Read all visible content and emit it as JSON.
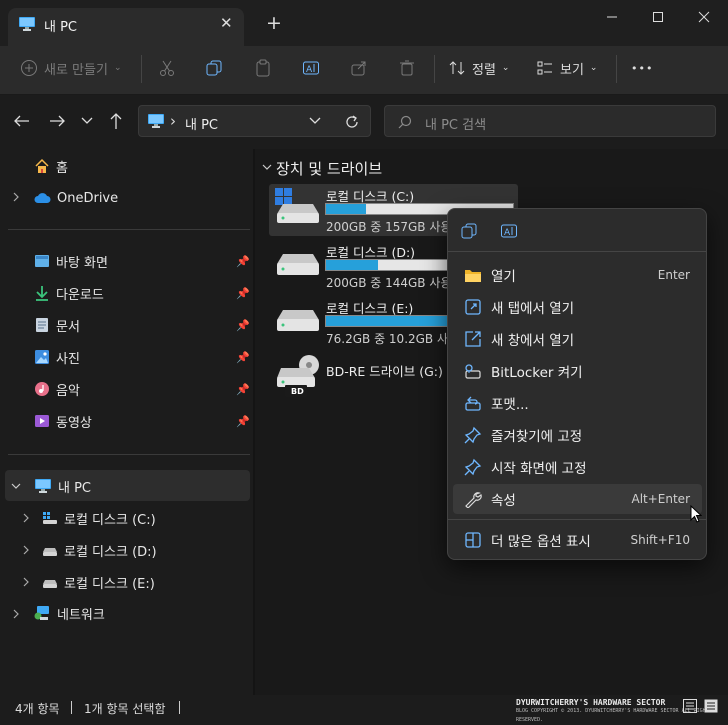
{
  "window": {
    "tab_title": "내 PC",
    "tab_close": "✕",
    "tab_add": "+"
  },
  "toolbar": {
    "new_label": "새로 만들기",
    "sort_label": "정렬",
    "view_label": "보기",
    "more_label": "•••"
  },
  "address": {
    "separator": "›",
    "path": "내 PC"
  },
  "search": {
    "placeholder": "내 PC 검색"
  },
  "sidebar": {
    "home": "홈",
    "onedrive": "OneDrive",
    "pinned": [
      {
        "label": "바탕 화면",
        "icon": "desktop-icon"
      },
      {
        "label": "다운로드",
        "icon": "download-icon"
      },
      {
        "label": "문서",
        "icon": "documents-icon"
      },
      {
        "label": "사진",
        "icon": "pictures-icon"
      },
      {
        "label": "음악",
        "icon": "music-icon"
      },
      {
        "label": "동영상",
        "icon": "videos-icon"
      }
    ],
    "this_pc": "내 PC",
    "drives": [
      "로컬 디스크 (C:)",
      "로컬 디스크 (D:)",
      "로컬 디스크 (E:)"
    ],
    "network": "네트워크"
  },
  "content": {
    "group_header": "장치 및 드라이브",
    "drives": [
      {
        "name": "로컬 디스크 (C:)",
        "size_text": "200GB 중 157GB 사용 가능",
        "used_fraction": 0.215
      },
      {
        "name": "로컬 디스크 (D:)",
        "size_text": "200GB 중 144GB 사용 가능",
        "used_fraction": 0.28
      },
      {
        "name": "로컬 디스크 (E:)",
        "size_text": "76.2GB 중 10.2GB 사용 가능",
        "used_fraction": 0.866
      },
      {
        "name": "BD-RE 드라이브 (G:)",
        "badge": "BD"
      }
    ]
  },
  "context_menu": {
    "items": [
      {
        "label": "열기",
        "shortcut": "Enter",
        "icon": "folder-open-icon"
      },
      {
        "label": "새 탭에서 열기",
        "shortcut": "",
        "icon": "new-tab-icon"
      },
      {
        "label": "새 창에서 열기",
        "shortcut": "",
        "icon": "new-window-icon"
      },
      {
        "label": "BitLocker 켜기",
        "shortcut": "",
        "icon": "bitlocker-key-icon"
      },
      {
        "label": "포맷...",
        "shortcut": "",
        "icon": "format-icon"
      },
      {
        "label": "즐겨찾기에 고정",
        "shortcut": "",
        "icon": "pin-icon"
      },
      {
        "label": "시작 화면에 고정",
        "shortcut": "",
        "icon": "pin-start-icon"
      },
      {
        "label": "속성",
        "shortcut": "Alt+Enter",
        "icon": "wrench-icon"
      },
      {
        "label": "더 많은 옵션 표시",
        "shortcut": "Shift+F10",
        "icon": "more-options-icon"
      }
    ]
  },
  "status": {
    "count": "4개 항목",
    "selected": "1개 항목 선택함",
    "watermark_title": "DYURWITCHERRY'S HARDWARE SECTOR",
    "watermark_sub": "BLOG COPYRIGHT © 2013. DYURWITCHERRY'S HARDWARE SECTOR ALL RIGHTS RESERVED."
  },
  "colors": {
    "accent": "#26a0da",
    "background": "#1c1c1c",
    "menu_bg": "#2c2c2c"
  }
}
